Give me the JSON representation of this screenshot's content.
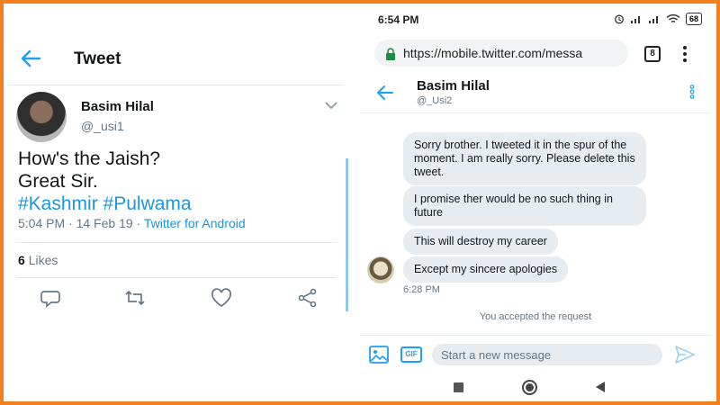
{
  "left": {
    "header_title": "Tweet",
    "author": {
      "name": "Basim Hilal",
      "handle": "@_usi1"
    },
    "tweet": {
      "line1": "How's the Jaish?",
      "line2": "Great Sir.",
      "hashtag1": "#Kashmir",
      "hashtag2": "#Pulwama"
    },
    "meta": {
      "time": "5:04 PM",
      "date": "14 Feb 19",
      "source": "Twitter for Android"
    },
    "likes": {
      "count": "6",
      "label": "Likes"
    },
    "icons": [
      "back-arrow-icon",
      "chevron-down-icon",
      "reply-icon",
      "retweet-icon",
      "like-icon",
      "share-icon"
    ]
  },
  "right": {
    "statusbar": {
      "time": "6:54 PM",
      "battery": "68"
    },
    "browser": {
      "url": "https://mobile.twitter.com/messa",
      "tabs_count": "8"
    },
    "dm": {
      "name": "Basim Hilal",
      "handle": "@_Usi2"
    },
    "messages": [
      {
        "text": "Sorry brother.  I tweeted it in the spur of the moment. I am really sorry. Please delete this tweet."
      },
      {
        "text": "I promise ther would be no such thing in future"
      },
      {
        "text": "This will destroy my career"
      },
      {
        "text": "Except my sincere apologies"
      }
    ],
    "message_time": "6:28 PM",
    "system_note": "You accepted the request",
    "composer_placeholder": "Start a new message"
  },
  "colors": {
    "border": "#f47f1f",
    "twitter_blue": "#1da1f2",
    "bubble": "#e6ecf0"
  }
}
